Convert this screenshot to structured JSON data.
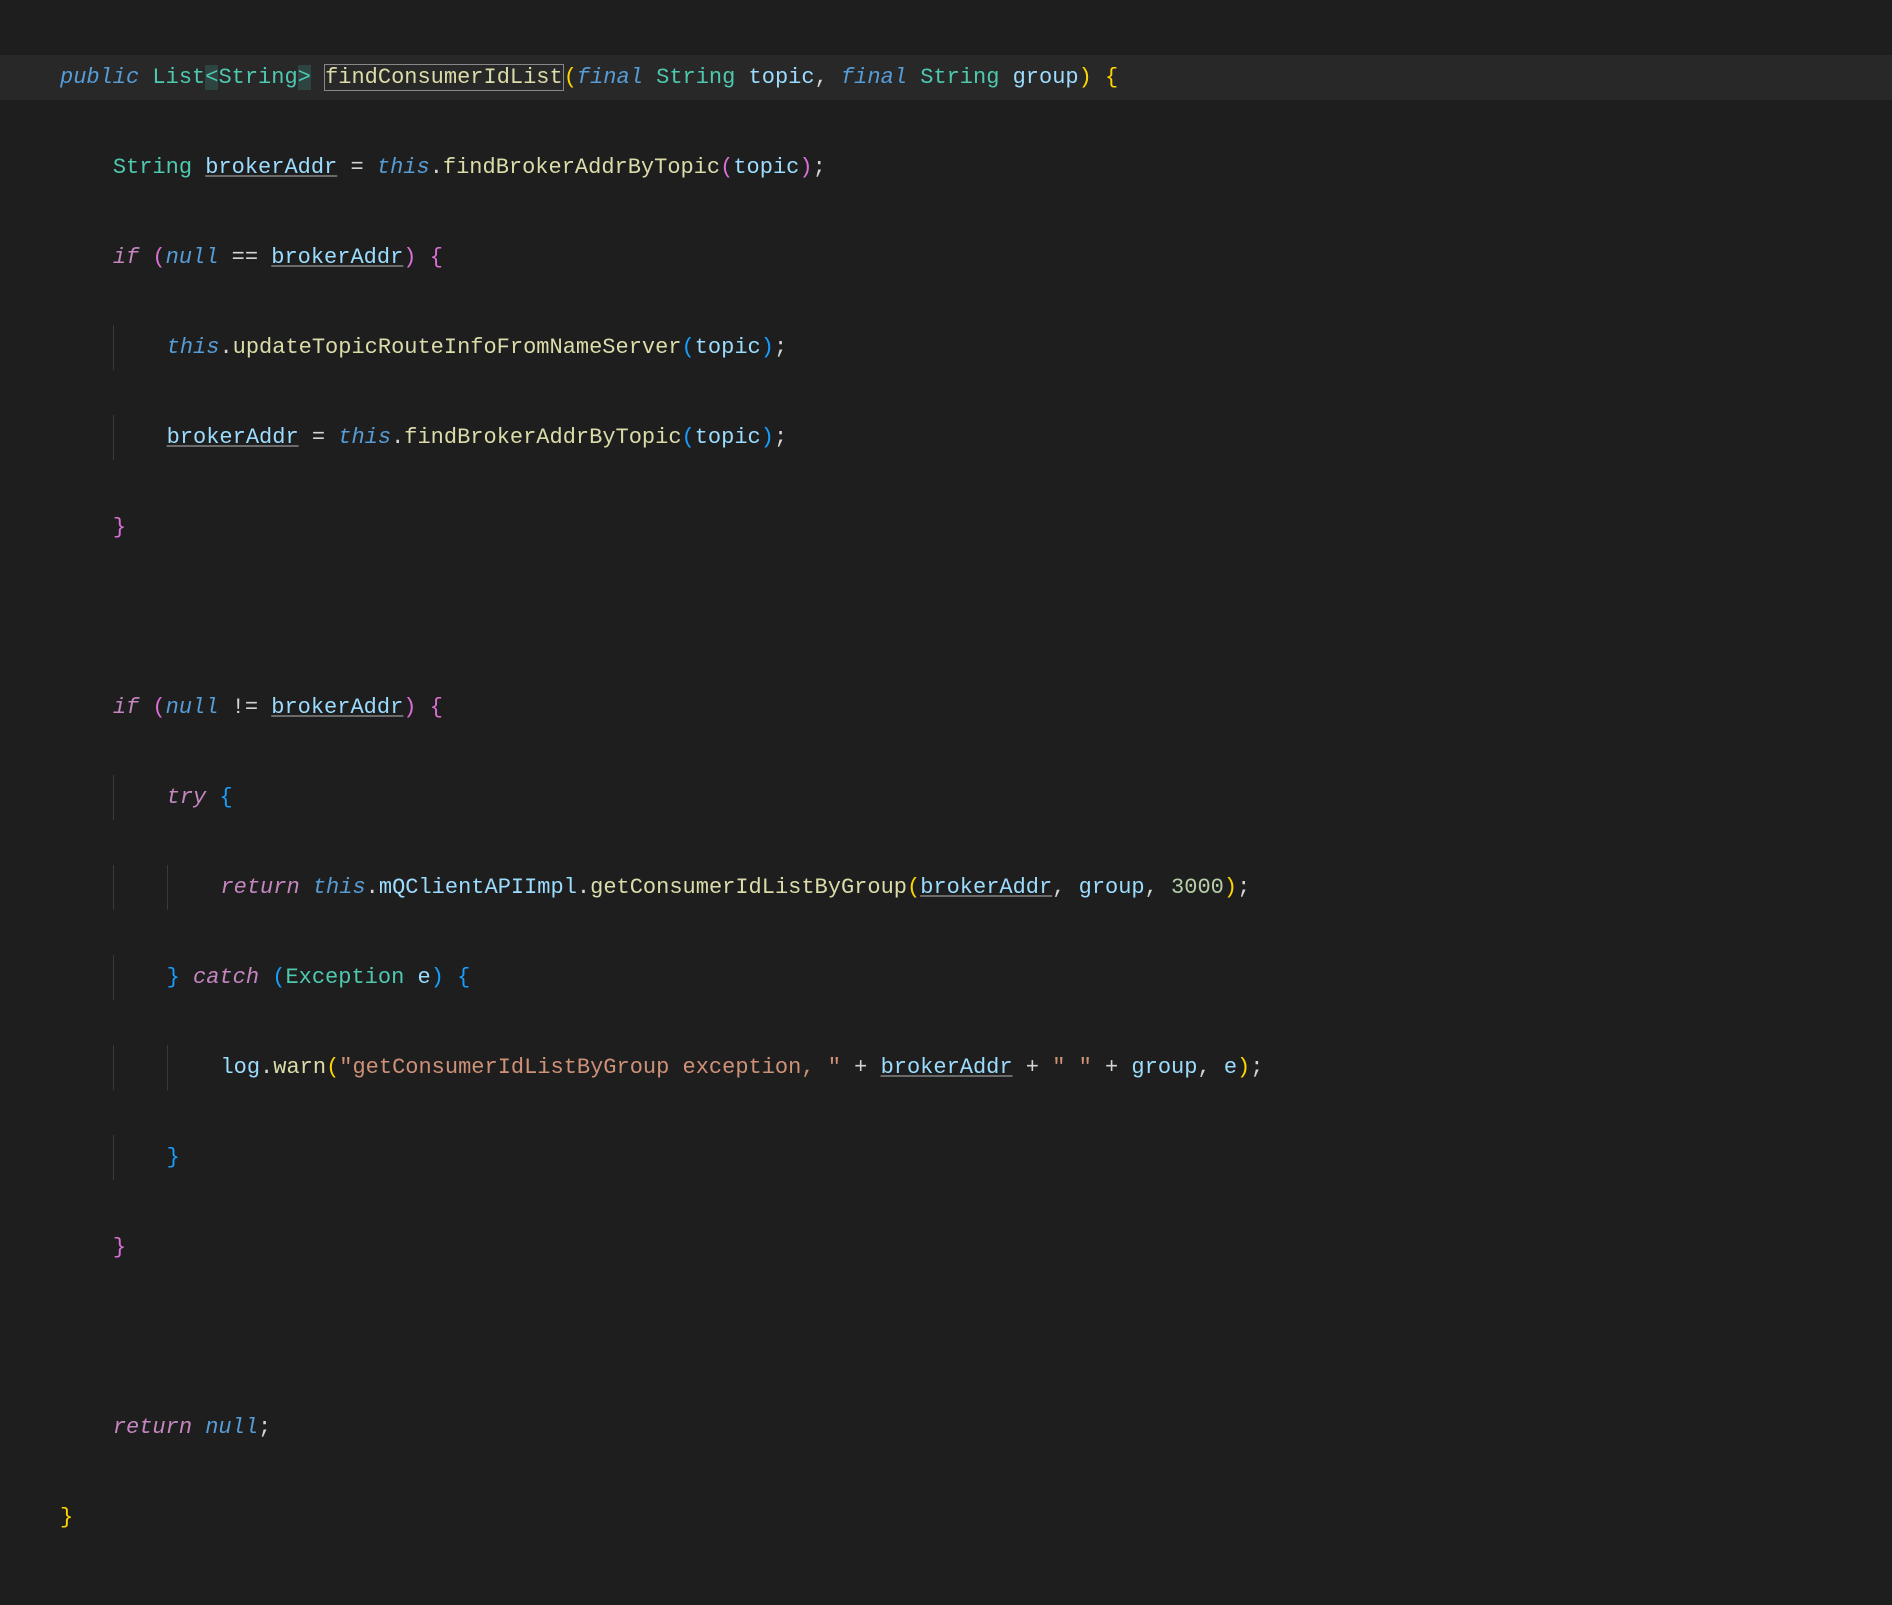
{
  "code": {
    "line1": {
      "public": "public",
      "list": "List",
      "lt": "<",
      "string": "String",
      "gt": ">",
      "method": "findConsumerIdList",
      "lp": "(",
      "final1": "final",
      "type1": "String",
      "param1": "topic",
      "comma": ",",
      "final2": "final",
      "type2": "String",
      "param2": "group",
      "rp": ")",
      "lb": "{"
    },
    "line2": {
      "type": "String",
      "var": "brokerAddr",
      "eq": "=",
      "this": "this",
      "dot": ".",
      "method": "findBrokerAddrByTopic",
      "lp": "(",
      "arg": "topic",
      "rp": ")",
      "semi": ";"
    },
    "line3": {
      "if": "if",
      "lp": "(",
      "null": "null",
      "op": "==",
      "var": "brokerAddr",
      "rp": ")",
      "lb": "{"
    },
    "line4": {
      "this": "this",
      "dot": ".",
      "method": "updateTopicRouteInfoFromNameServer",
      "lp": "(",
      "arg": "topic",
      "rp": ")",
      "semi": ";"
    },
    "line5": {
      "var": "brokerAddr",
      "eq": "=",
      "this": "this",
      "dot": ".",
      "method": "findBrokerAddrByTopic",
      "lp": "(",
      "arg": "topic",
      "rp": ")",
      "semi": ";"
    },
    "line6": {
      "rb": "}"
    },
    "line8": {
      "if": "if",
      "lp": "(",
      "null": "null",
      "op": "!=",
      "var": "brokerAddr",
      "rp": ")",
      "lb": "{"
    },
    "line9": {
      "try": "try",
      "lb": "{"
    },
    "line10": {
      "return": "return",
      "this": "this",
      "dot1": ".",
      "prop": "mQClientAPIImpl",
      "dot2": ".",
      "method": "getConsumerIdListByGroup",
      "lp": "(",
      "arg1": "brokerAddr",
      "c1": ",",
      "arg2": "group",
      "c2": ",",
      "num": "3000",
      "rp": ")",
      "semi": ";"
    },
    "line11": {
      "rb": "}",
      "catch": "catch",
      "lp": "(",
      "type": "Exception",
      "var": "e",
      "rp": ")",
      "lb": "{"
    },
    "line12": {
      "log": "log",
      "dot": ".",
      "method": "warn",
      "lp": "(",
      "str1": "\"getConsumerIdListByGroup exception, \"",
      "plus1": "+",
      "var1": "brokerAddr",
      "plus2": "+",
      "str2": "\" \"",
      "plus3": "+",
      "var2": "group",
      "c": ",",
      "var3": "e",
      "rp": ")",
      "semi": ";"
    },
    "line13": {
      "rb": "}"
    },
    "line14": {
      "rb": "}"
    },
    "line16": {
      "return": "return",
      "null": "null",
      "semi": ";"
    },
    "line17": {
      "rb": "}"
    }
  }
}
